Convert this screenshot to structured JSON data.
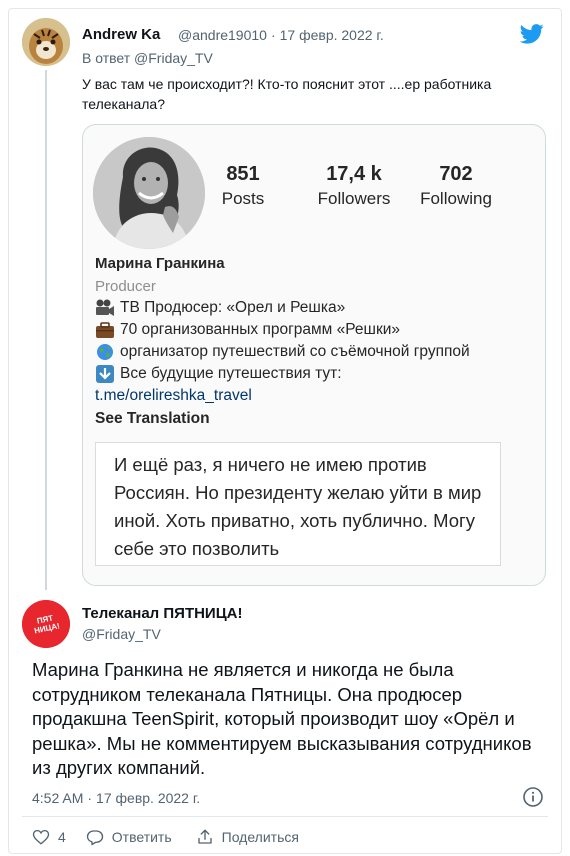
{
  "reply_tweet": {
    "author_name": "Andrew Ka",
    "author_handle": "@andre19010",
    "date": "17 февр. 2022 г.",
    "reply_prefix": "В ответ",
    "reply_to": "@Friday_TV",
    "text": "У вас там че происходит?! Кто-то пояснит этот ....ер работника телеканала?"
  },
  "instagram_card": {
    "stats": [
      {
        "value": "851",
        "label": "Posts"
      },
      {
        "value": "17,4 k",
        "label": "Followers"
      },
      {
        "value": "702",
        "label": "Following"
      }
    ],
    "name": "Марина Гранкина",
    "role": "Producer",
    "bio_lines": [
      {
        "icon": "movie-camera-icon",
        "text": "ТВ Продюсер: «Орел и Решка»"
      },
      {
        "icon": "briefcase-icon",
        "text": "70 организованных программ «Решки»"
      },
      {
        "icon": "globe-icon",
        "text": "организатор путешествий со съёмочной группой"
      },
      {
        "icon": "down-arrow-icon",
        "text": "Все будущие путешествия тут:"
      }
    ],
    "link": "t.me/orelireshka_travel",
    "see_translation": "See Translation",
    "quote": "И ещё раз, я ничего не имею против Россиян. Но президенту желаю уйти в мир иной. Хоть приватно, хоть публично. Могу себе это позволить"
  },
  "main_tweet": {
    "author_name": "Телеканал ПЯТНИЦА!",
    "author_handle": "@Friday_TV",
    "avatar_text": "ПЯТНИЦА!",
    "text": "Марина Гранкина не является и никогда не была сотрудником телеканала Пятницы. Она продюсер продакшна TeenSpirit, который производит шоу «Орёл и решка». Мы не комментируем высказывания сотрудников из других компаний.",
    "time": "4:52 AM",
    "date": "17 февр. 2022 г.",
    "likes": "4",
    "reply_label": "Ответить",
    "share_label": "Поделиться"
  },
  "colors": {
    "twitter_blue": "#1d9bf0",
    "secondary_text": "#536471",
    "brand_red": "#e8262d",
    "ig_link": "#00376b"
  }
}
